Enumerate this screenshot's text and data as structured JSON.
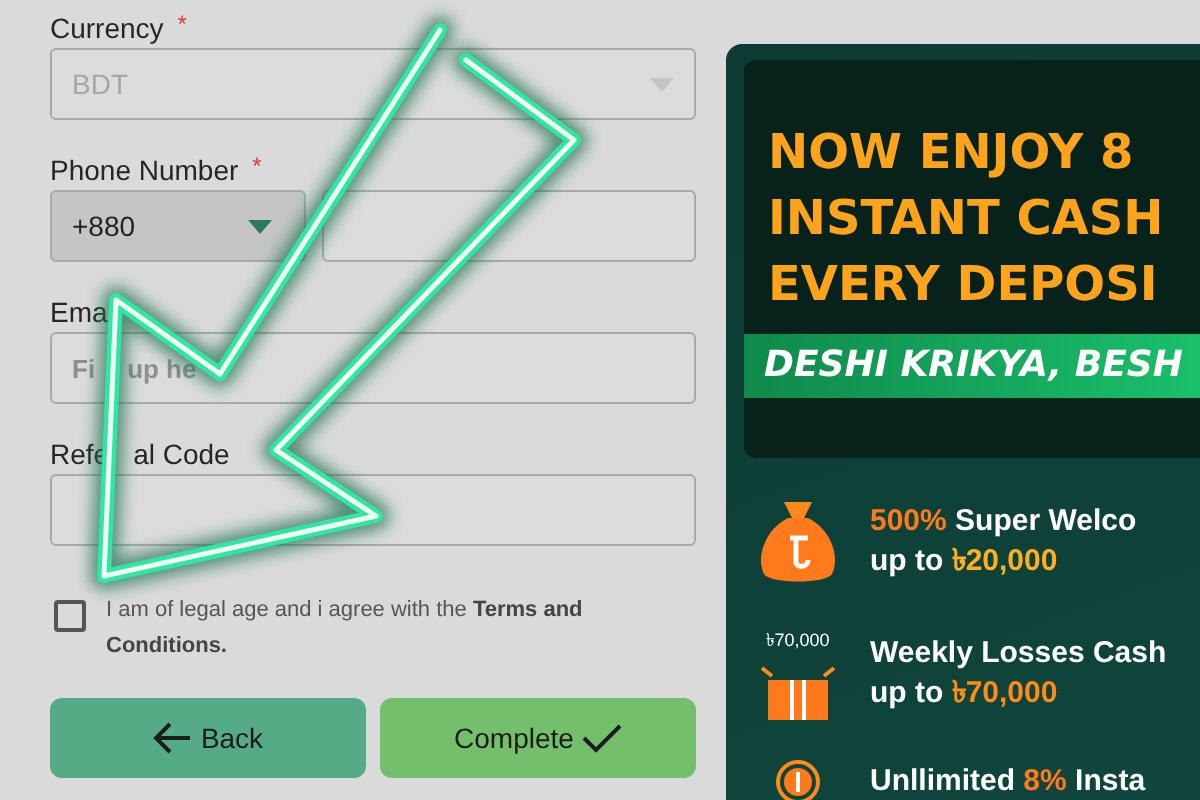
{
  "form": {
    "fields": [
      {
        "kind": "select",
        "label": [
          "Currency"
        ],
        "required_mark": "*",
        "value": "BDT",
        "disabled": true
      },
      {
        "kind": "phone",
        "label": [
          "Phone Number"
        ],
        "required_mark": "*",
        "code": "+880"
      },
      {
        "kind": "text",
        "label": [
          "Ema"
        ],
        "placeholder": [
          "Fi",
          "up he"
        ]
      },
      {
        "kind": "text",
        "label": [
          "Refe",
          "al Code"
        ]
      }
    ],
    "agreement": {
      "text": "I am of legal age and i agree with the **Terms and Conditions.**",
      "checked": false
    },
    "buttons": [
      {
        "kind": "back",
        "label": "Back"
      },
      {
        "kind": "complete",
        "label": "Complete"
      }
    ]
  },
  "banner": {
    "headline": [
      "NOW ENJOY 8",
      "INSTANT CASH",
      "EVERY DEPOSI"
    ],
    "slogan": "DESHI KRIKYA, BESH",
    "offers": [
      {
        "kind": "money-bag",
        "lines": [
          [
            {
              "text": "500%",
              "color": "#ff7a1a"
            },
            {
              "text": " Super Welco",
              "color": "#ffffff"
            }
          ],
          [
            {
              "text": "up to ",
              "color": "#ffffff"
            },
            {
              "text": "৳20,000",
              "color": "#ffb020"
            }
          ]
        ]
      },
      {
        "kind": "gift",
        "icon_label": "৳70,000",
        "lines": [
          [
            {
              "text": "Weekly Losses Cash",
              "color": "#ffffff"
            }
          ],
          [
            {
              "text": "up to ",
              "color": "#ffffff"
            },
            {
              "text": "৳70,000",
              "color": "#ff8a1a"
            }
          ]
        ]
      },
      {
        "kind": "coin",
        "lines": [
          [
            {
              "text": "Unllimited ",
              "color": "#ffffff"
            },
            {
              "text": "8%",
              "color": "#ff7a1a"
            },
            {
              "text": " Insta",
              "color": "#ffffff"
            }
          ]
        ]
      }
    ]
  }
}
